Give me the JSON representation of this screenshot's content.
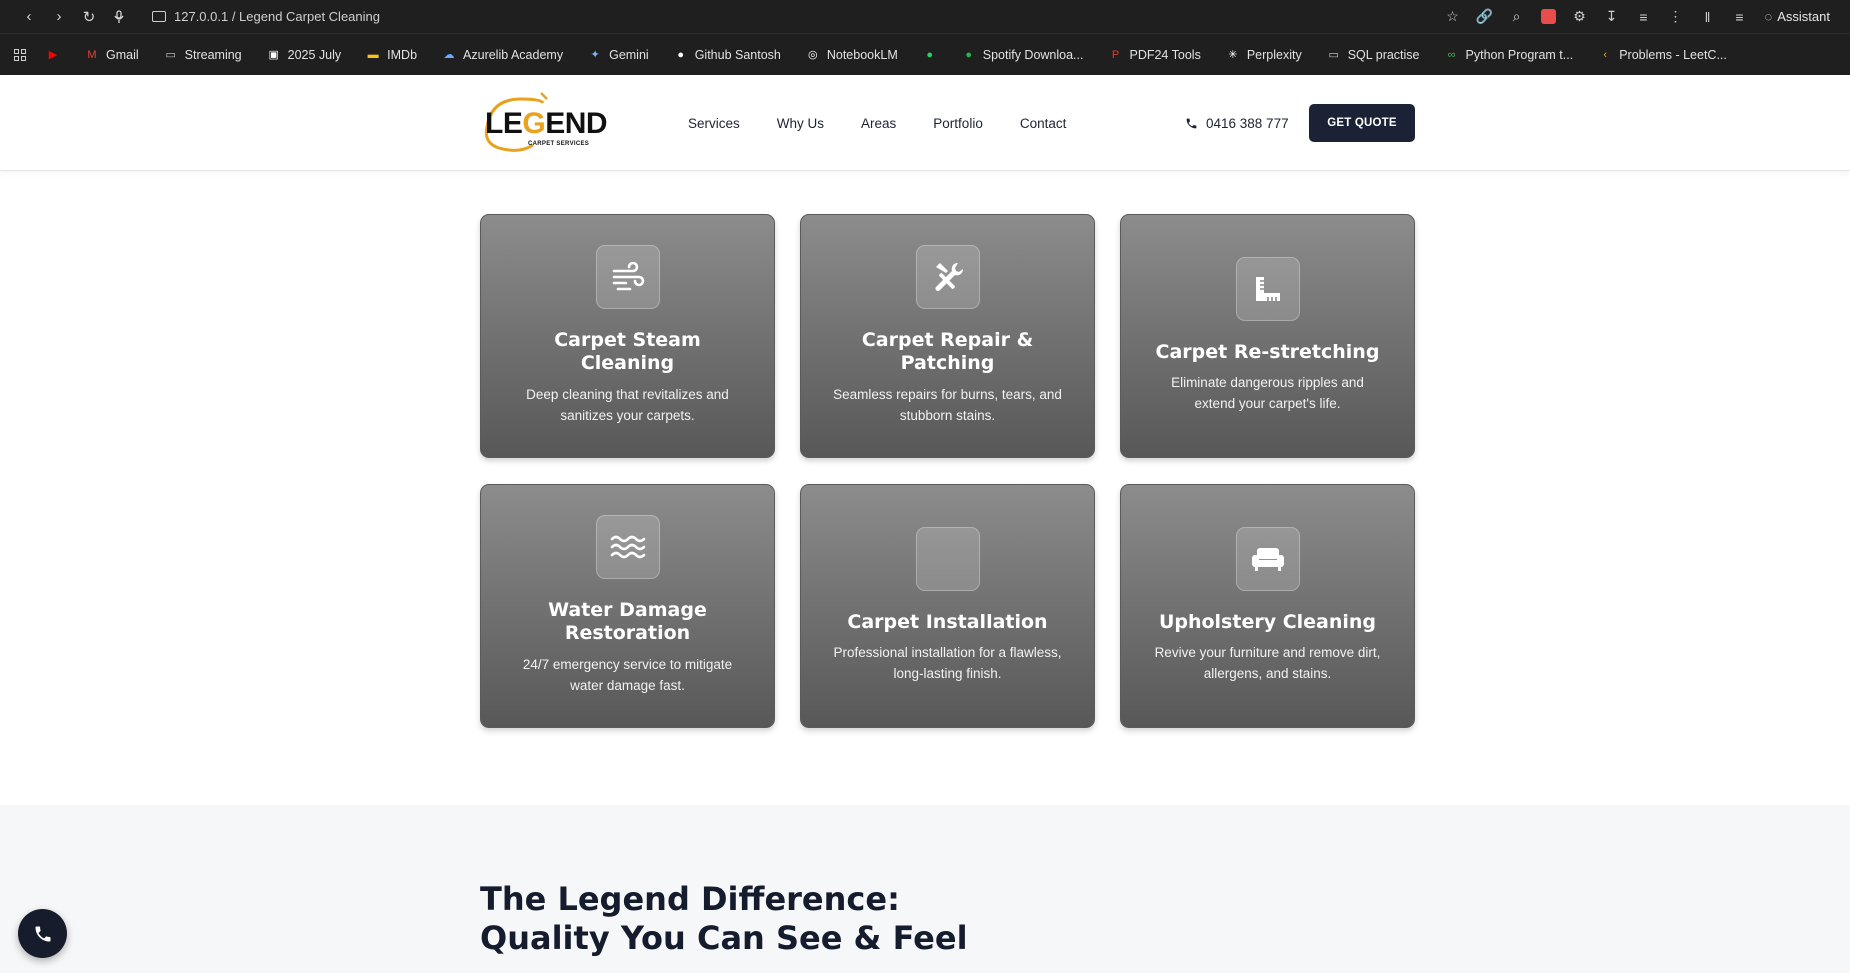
{
  "browser": {
    "address": "127.0.0.1 / Legend Carpet Cleaning",
    "assistant_label": "Assistant",
    "bookmarks": [
      {
        "label": "",
        "icon": "youtube-icon",
        "color": "#ff0000"
      },
      {
        "label": "Gmail",
        "icon": "gmail-icon",
        "color": "#ea4335"
      },
      {
        "label": "Streaming",
        "icon": "folder-icon",
        "color": "#cfcfcf"
      },
      {
        "label": "2025 July",
        "icon": "calendar-icon",
        "color": "#ffffff"
      },
      {
        "label": "IMDb",
        "icon": "imdb-icon",
        "color": "#f5c518"
      },
      {
        "label": "Azurelib Academy",
        "icon": "cloud-icon",
        "color": "#6fa8ff"
      },
      {
        "label": "Gemini",
        "icon": "gemini-icon",
        "color": "#7ab4ff"
      },
      {
        "label": "Github Santosh",
        "icon": "github-icon",
        "color": "#ffffff"
      },
      {
        "label": "NotebookLM",
        "icon": "notebooklm-icon",
        "color": "#ffffff"
      },
      {
        "label": "",
        "icon": "whatsapp-icon",
        "color": "#25d366"
      },
      {
        "label": "Spotify Downloa...",
        "icon": "spotify-icon",
        "color": "#1db954"
      },
      {
        "label": "PDF24 Tools",
        "icon": "pdf24-icon",
        "color": "#e53935"
      },
      {
        "label": "Perplexity",
        "icon": "perplexity-icon",
        "color": "#ffffff"
      },
      {
        "label": "SQL practise",
        "icon": "folder-icon",
        "color": "#cfcfcf"
      },
      {
        "label": "Python Program t...",
        "icon": "python-icon",
        "color": "#4caf50"
      },
      {
        "label": "Problems - LeetC...",
        "icon": "leetcode-icon",
        "color": "#ffa116"
      }
    ]
  },
  "header": {
    "logo_word_pre": "LE",
    "logo_word_g": "G",
    "logo_word_post": "END",
    "logo_sub": "CARPET SERVICES",
    "nav": [
      "Services",
      "Why Us",
      "Areas",
      "Portfolio",
      "Contact"
    ],
    "phone": "0416 388 777",
    "cta": "GET QUOTE"
  },
  "services": [
    {
      "title": "Carpet Steam Cleaning",
      "desc": "Deep cleaning that revitalizes and sanitizes your carpets.",
      "icon": "wind-icon"
    },
    {
      "title": "Carpet Repair & Patching",
      "desc": "Seamless repairs for burns, tears, and stubborn stains.",
      "icon": "tools-icon"
    },
    {
      "title": "Carpet Re-stretching",
      "desc": "Eliminate dangerous ripples and extend your carpet's life.",
      "icon": "ruler-icon"
    },
    {
      "title": "Water Damage Restoration",
      "desc": "24/7 emergency service to mitigate water damage fast.",
      "icon": "water-icon"
    },
    {
      "title": "Carpet Installation",
      "desc": "Professional installation for a flawless, long-lasting finish.",
      "icon": "empty-icon"
    },
    {
      "title": "Upholstery Cleaning",
      "desc": "Revive your furniture and remove dirt, allergens, and stains.",
      "icon": "sofa-icon"
    }
  ],
  "difference": {
    "title_line1": "The Legend Difference:",
    "title_line2": "Quality You Can See & Feel"
  }
}
